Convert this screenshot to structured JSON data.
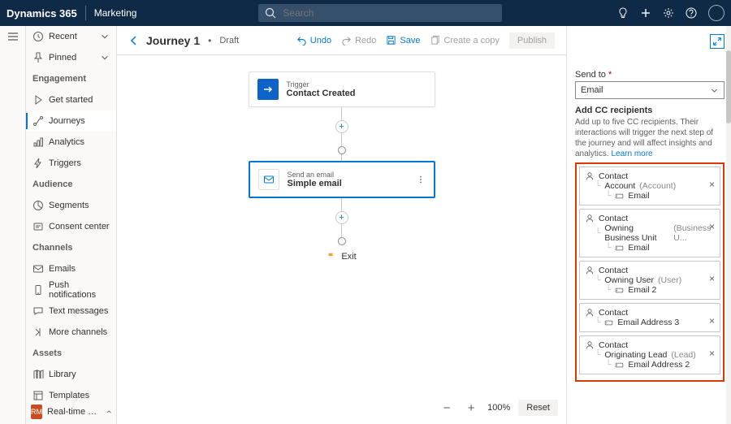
{
  "topbar": {
    "brand": "Dynamics 365",
    "app": "Marketing",
    "search_placeholder": "Search"
  },
  "nav": {
    "recent": "Recent",
    "pinned": "Pinned",
    "groups": {
      "engagement": "Engagement",
      "audience": "Audience",
      "channels": "Channels",
      "assets": "Assets"
    },
    "items": {
      "get_started": "Get started",
      "journeys": "Journeys",
      "analytics": "Analytics",
      "triggers": "Triggers",
      "segments": "Segments",
      "consent": "Consent center",
      "emails": "Emails",
      "push": "Push notifications",
      "text": "Text messages",
      "more_channels": "More channels",
      "library": "Library",
      "templates": "Templates"
    },
    "area": "Real-time marketi...",
    "area_badge": "RM"
  },
  "cmdbar": {
    "title": "Journey 1",
    "status": "Draft",
    "undo": "Undo",
    "redo": "Redo",
    "save": "Save",
    "copy": "Create a copy",
    "publish": "Publish"
  },
  "flow": {
    "trigger_kind": "Trigger",
    "trigger_name": "Contact Created",
    "email_kind": "Send an email",
    "email_name": "Simple email",
    "exit": "Exit"
  },
  "zoom": {
    "level": "100%",
    "reset": "Reset"
  },
  "side": {
    "sendto_label": "Send to",
    "sendto_value": "Email",
    "cc_label": "Add CC recipients",
    "cc_help": "Add up to five CC recipients. Their interactions will trigger the next step of the journey and will affect insights and analytics.",
    "learn_more": "Learn more",
    "cc": [
      {
        "entity": "Contact",
        "relation": "Account",
        "reltype": "(Account)",
        "field": "Email"
      },
      {
        "entity": "Contact",
        "relation": "Owning Business Unit",
        "reltype": "(Business U...",
        "field": "Email"
      },
      {
        "entity": "Contact",
        "relation": "Owning User",
        "reltype": "(User)",
        "field": "Email 2"
      },
      {
        "entity": "Contact",
        "relation": "",
        "reltype": "",
        "field": "Email Address 3"
      },
      {
        "entity": "Contact",
        "relation": "Originating Lead",
        "reltype": "(Lead)",
        "field": "Email Address 2"
      }
    ]
  }
}
